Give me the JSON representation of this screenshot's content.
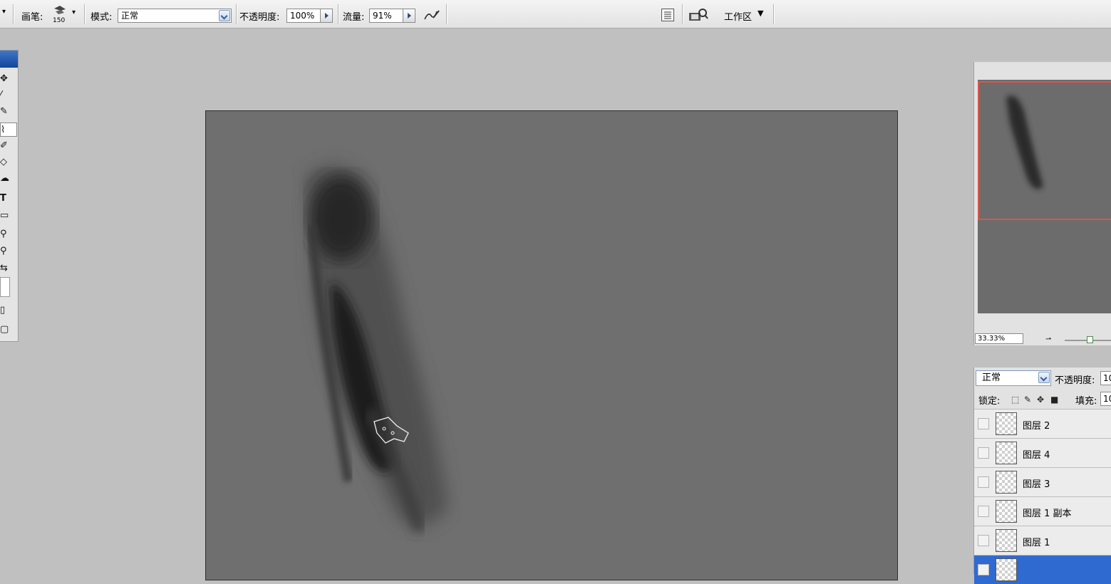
{
  "options_bar": {
    "brush_label": "画笔:",
    "brush_size": "150",
    "mode_label": "模式:",
    "mode_value": "正常",
    "opacity_label": "不透明度:",
    "opacity_value": "100%",
    "flow_label": "流量:",
    "flow_value": "91%",
    "workspace_label": "工作区"
  },
  "navigator": {
    "zoom": "33.33%"
  },
  "layers_panel": {
    "blend_mode": "正常",
    "opacity_label": "不透明度:",
    "opacity_value": "10",
    "lock_label": "锁定:",
    "fill_label": "填充:",
    "fill_value": "10",
    "layers": [
      {
        "name": "图层 2",
        "selected": false
      },
      {
        "name": "图层 4",
        "selected": false
      },
      {
        "name": "图层 3",
        "selected": false
      },
      {
        "name": "图层 1 副本",
        "selected": false
      },
      {
        "name": "图层 1",
        "selected": false
      },
      {
        "name": "",
        "selected": true
      }
    ]
  },
  "colors": {
    "workspace_bg": "#c0c0c0",
    "canvas_bg": "#6f6f6f",
    "selection_blue": "#2f6ad0",
    "navigator_frame": "#e0534a"
  }
}
